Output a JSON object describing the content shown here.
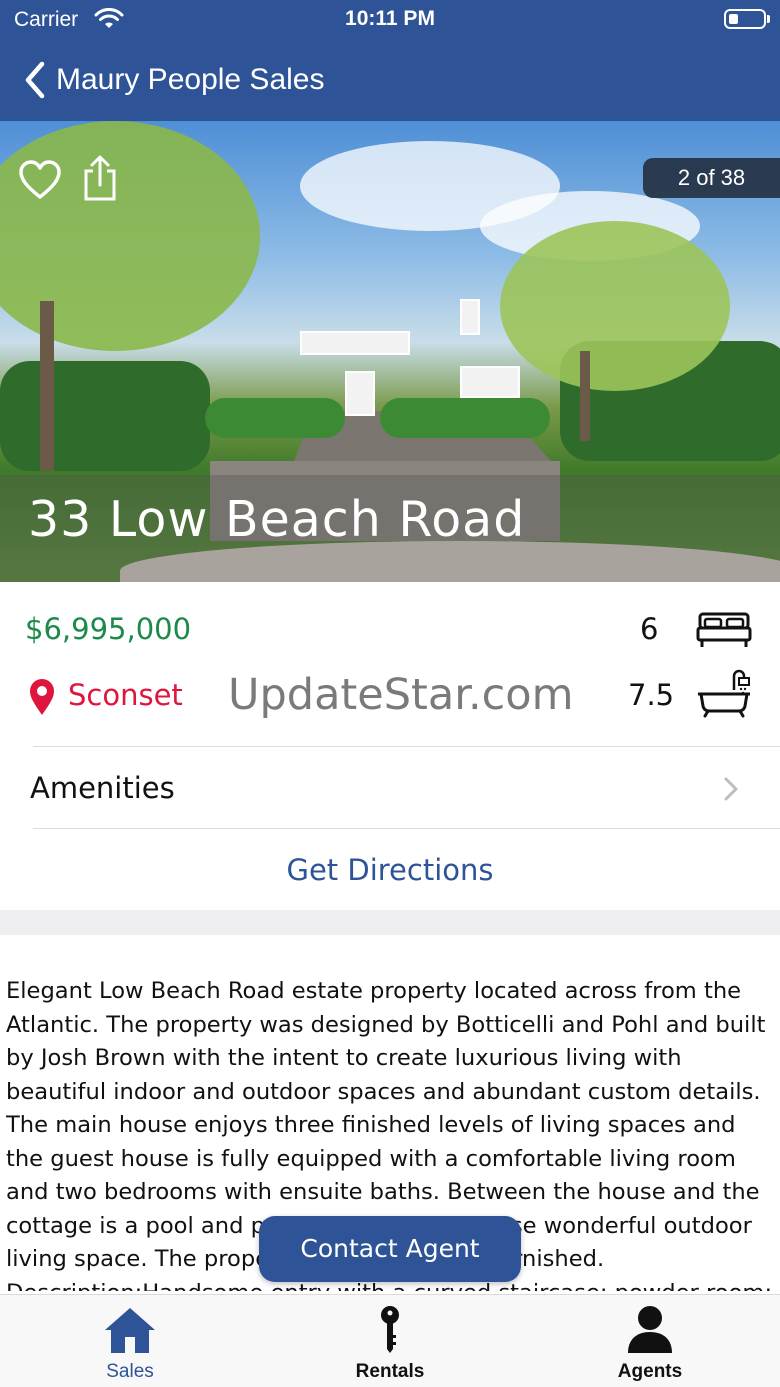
{
  "status_bar": {
    "carrier": "Carrier",
    "time": "10:11 PM"
  },
  "nav": {
    "back_icon": "chevron-left-icon",
    "title": "Maury People Sales"
  },
  "hero": {
    "photo_counter": "2 of 38",
    "favorite_icon": "heart-icon",
    "share_icon": "share-icon",
    "address": "33 Low Beach Road"
  },
  "summary": {
    "price": "$6,995,000",
    "bedrooms": "6",
    "bed_icon": "bed-icon",
    "location": "Sconset",
    "location_icon": "map-pin-icon",
    "watermark": "UpdateStar.com",
    "bathrooms": "7.5",
    "bath_icon": "bathtub-icon"
  },
  "amenities": {
    "label": "Amenities",
    "chevron_icon": "chevron-right-icon"
  },
  "directions": {
    "label": "Get Directions"
  },
  "description": "Elegant Low Beach Road estate property located across from the Atlantic. The property was designed by Botticelli and Pohl and built by Josh Brown with the intent to create luxurious living with beautiful indoor and outdoor spaces and abundant custom details. The main house enjoys three finished levels of living spaces and the guest house is fully equipped with a comfortable living room and two bedrooms with ensuite baths. Between the house and the cottage is a pool and pool house that compose wonderful outdoor living space. The property is being offered furnished. Description:Handsome entry with a curved staircase; powder room; living room with fireplace",
  "contact_button": "Contact Agent",
  "tabs": [
    {
      "label": "Sales",
      "icon": "house-icon",
      "active": true
    },
    {
      "label": "Rentals",
      "icon": "key-icon",
      "active": false
    },
    {
      "label": "Agents",
      "icon": "person-icon",
      "active": false
    }
  ],
  "colors": {
    "brand": "#2e5497",
    "price": "#1c8a4a",
    "location": "#e0153d",
    "active_tab": "#2e5497",
    "inactive_tab": "#111111"
  }
}
